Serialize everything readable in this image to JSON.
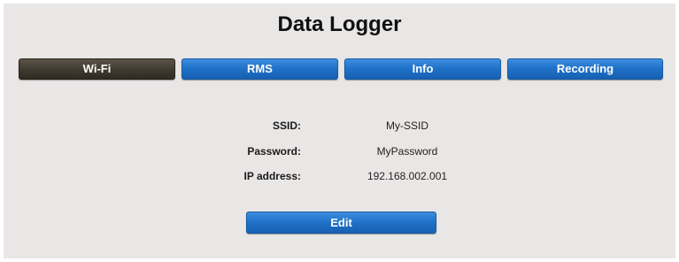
{
  "app": {
    "title": "Data Logger"
  },
  "tabs": [
    {
      "label": "Wi-Fi",
      "active": true
    },
    {
      "label": "RMS",
      "active": false
    },
    {
      "label": "Info",
      "active": false
    },
    {
      "label": "Recording",
      "active": false
    }
  ],
  "wifi": {
    "ssid_label": "SSID:",
    "ssid_value": "My-SSID",
    "password_label": "Password:",
    "password_value": "MyPassword",
    "ip_label": "IP address:",
    "ip_value": "192.168.002.001"
  },
  "actions": {
    "edit_label": "Edit"
  },
  "colors": {
    "panel_bg": "#e9e7e6",
    "tab_blue": "#2073c9",
    "tab_active": "#3f3a2f"
  }
}
